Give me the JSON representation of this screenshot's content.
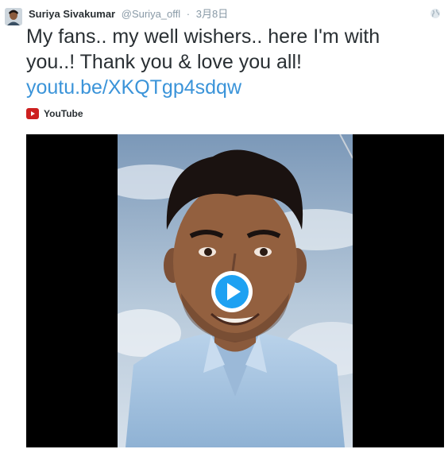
{
  "tweet": {
    "author_name": "Suriya Sivakumar",
    "handle_prefix": "@",
    "handle_user": "Suriya_offl",
    "separator": "·",
    "timestamp": "3月8日",
    "text_line": "My fans.. my well wishers.. here I'm with you..! Thank you & love you all!",
    "link": "youtu.be/XKQTgp4sdqw"
  },
  "card": {
    "source_label": "YouTube",
    "source_icon": "youtube-icon",
    "play_icon": "play-icon"
  },
  "colors": {
    "link": "#3b94d9",
    "play_button": "#1da1f2",
    "youtube_red": "#cd201f"
  }
}
